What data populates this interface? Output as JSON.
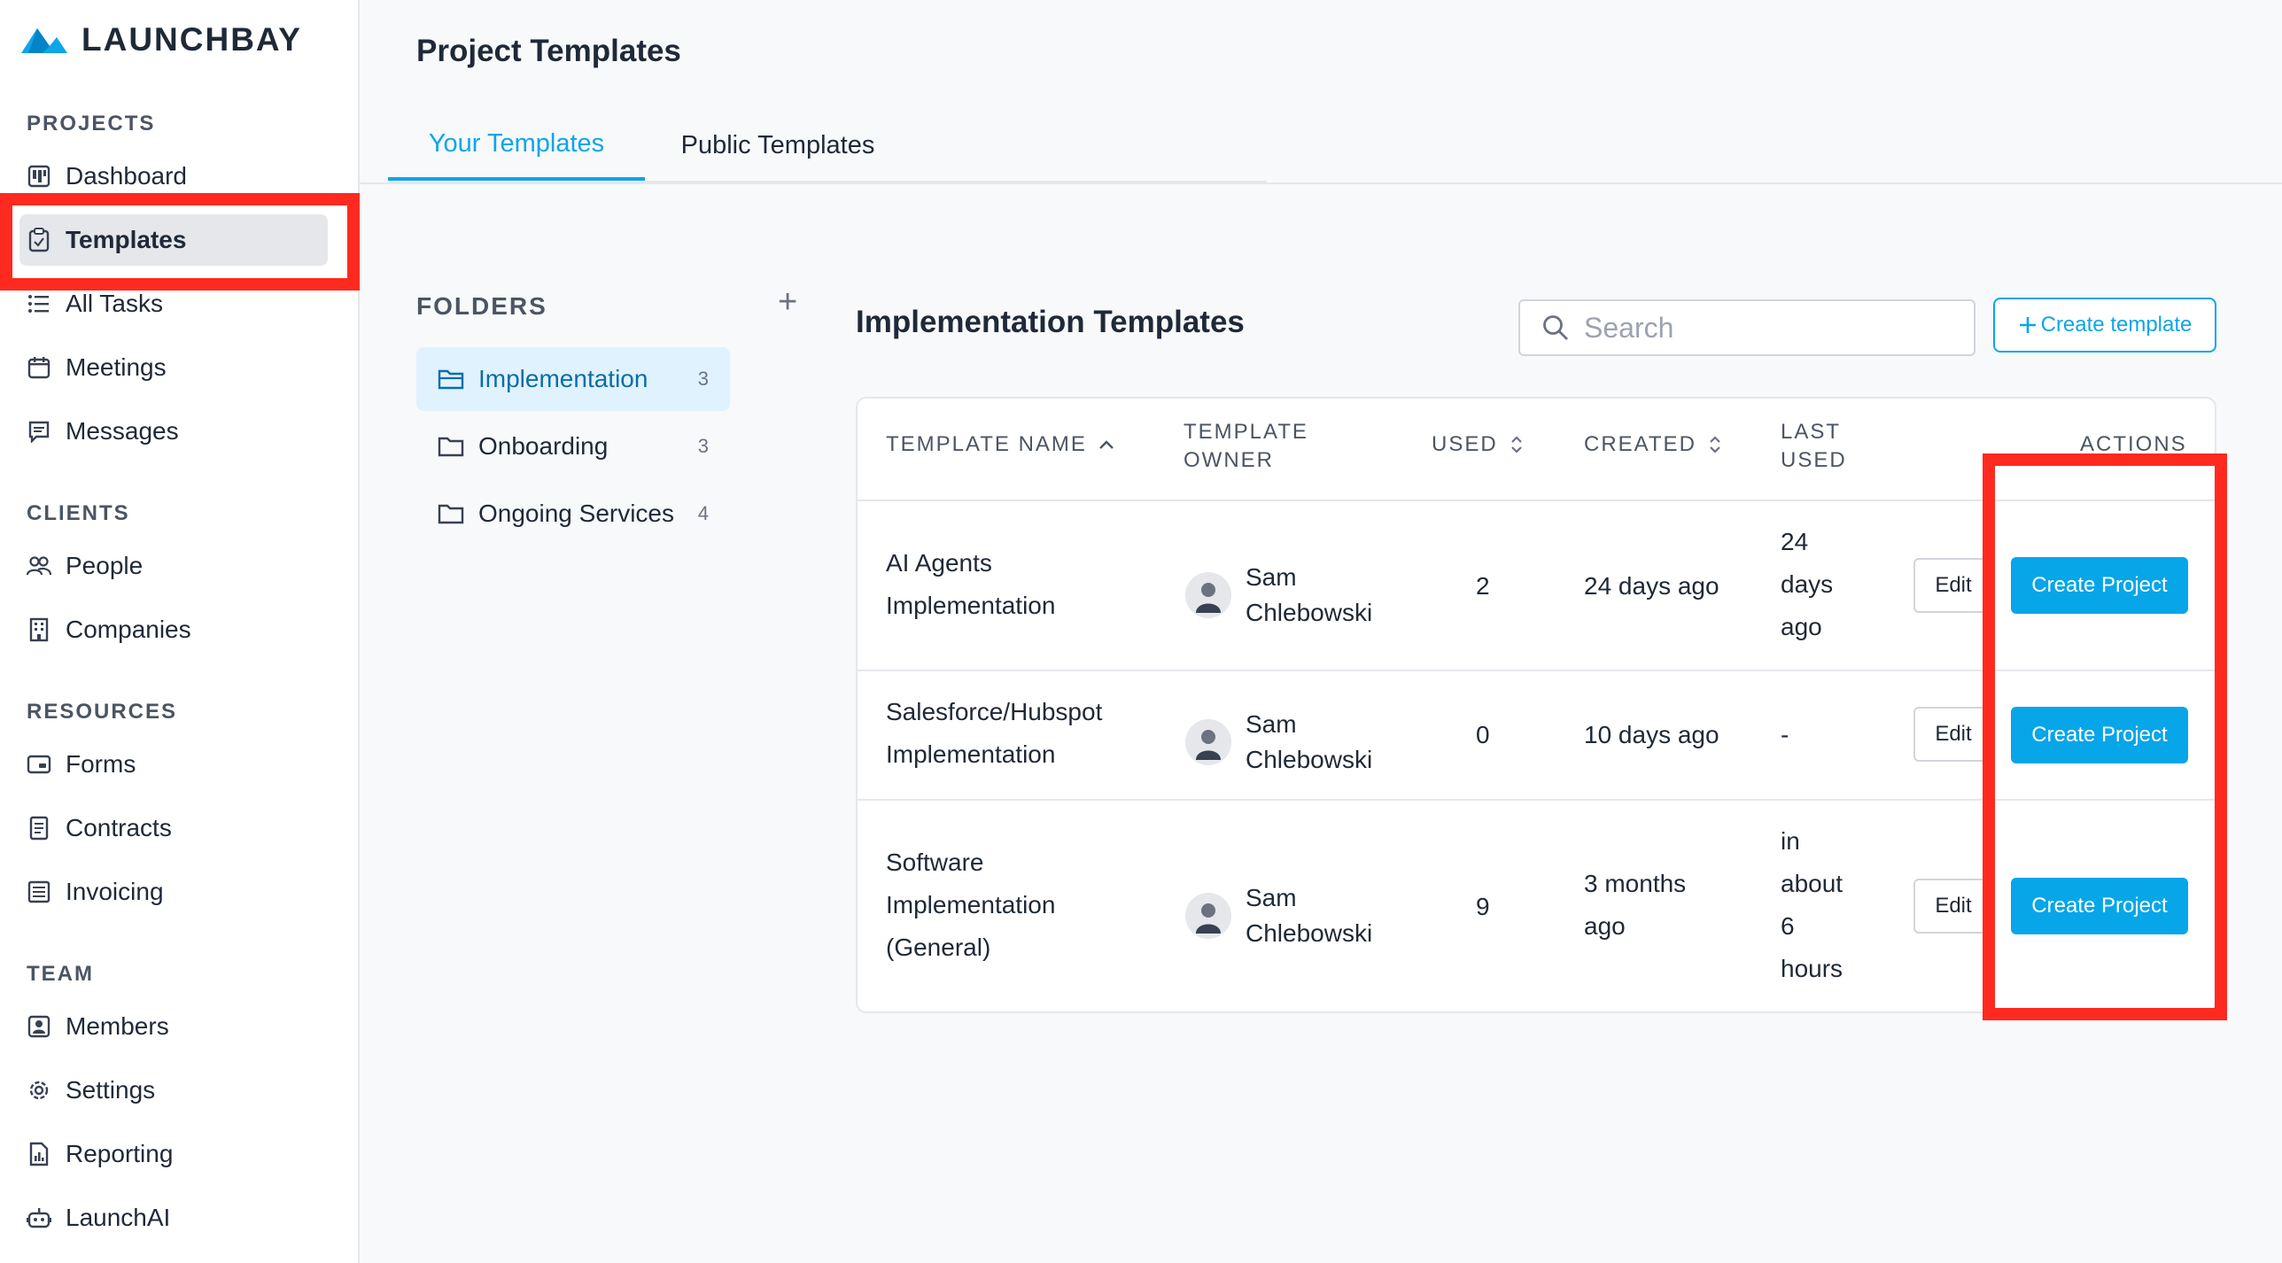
{
  "brand": {
    "name": "LAUNCHBAY",
    "accent": "#0ea5e9",
    "highlight": "#ff2a1f"
  },
  "sidebar": {
    "sections": [
      {
        "title": "PROJECTS",
        "items": [
          {
            "label": "Dashboard",
            "icon": "dashboard-icon"
          },
          {
            "label": "Templates",
            "icon": "clipboard-icon",
            "active": true
          },
          {
            "label": "All Tasks",
            "icon": "list-icon"
          },
          {
            "label": "Meetings",
            "icon": "calendar-icon"
          },
          {
            "label": "Messages",
            "icon": "message-icon"
          }
        ]
      },
      {
        "title": "CLIENTS",
        "items": [
          {
            "label": "People",
            "icon": "people-icon"
          },
          {
            "label": "Companies",
            "icon": "building-icon"
          }
        ]
      },
      {
        "title": "RESOURCES",
        "items": [
          {
            "label": "Forms",
            "icon": "form-icon"
          },
          {
            "label": "Contracts",
            "icon": "document-icon"
          },
          {
            "label": "Invoicing",
            "icon": "invoice-icon"
          }
        ]
      },
      {
        "title": "TEAM",
        "items": [
          {
            "label": "Members",
            "icon": "member-icon"
          },
          {
            "label": "Settings",
            "icon": "gear-icon"
          },
          {
            "label": "Reporting",
            "icon": "report-icon"
          },
          {
            "label": "LaunchAI",
            "icon": "robot-icon"
          }
        ]
      }
    ]
  },
  "header": {
    "title": "Project Templates",
    "tabs": [
      {
        "label": "Your Templates",
        "active": true
      },
      {
        "label": "Public Templates",
        "active": false
      }
    ]
  },
  "folders": {
    "title": "FOLDERS",
    "add_label": "+",
    "items": [
      {
        "label": "Implementation",
        "count": "3",
        "active": true
      },
      {
        "label": "Onboarding",
        "count": "3",
        "active": false
      },
      {
        "label": "Ongoing Services",
        "count": "4",
        "active": false
      }
    ]
  },
  "templates": {
    "title": "Implementation Templates",
    "search_placeholder": "Search",
    "create_label": "Create template",
    "columns": [
      {
        "label": "TEMPLATE NAME",
        "sort": "asc"
      },
      {
        "label": "TEMPLATE OWNER"
      },
      {
        "label": "USED",
        "sort": "both"
      },
      {
        "label": "CREATED",
        "sort": "both"
      },
      {
        "label": "LAST USED"
      },
      {
        "label": "ACTIONS"
      }
    ],
    "rows": [
      {
        "name": "AI Agents Implementation",
        "owner": "Sam Chlebowski",
        "used": "2",
        "created": "24 days ago",
        "last_used": "24 days ago",
        "edit": "Edit",
        "create": "Create Project"
      },
      {
        "name": "Salesforce/Hubspot Implementation",
        "owner": "Sam Chlebowski",
        "used": "0",
        "created": "10 days ago",
        "last_used": "-",
        "edit": "Edit",
        "create": "Create Project"
      },
      {
        "name": "Software Implementation (General)",
        "owner": "Sam Chlebowski",
        "used": "9",
        "created": "3 months ago",
        "last_used": "in about 6 hours",
        "edit": "Edit",
        "create": "Create Project"
      }
    ]
  }
}
